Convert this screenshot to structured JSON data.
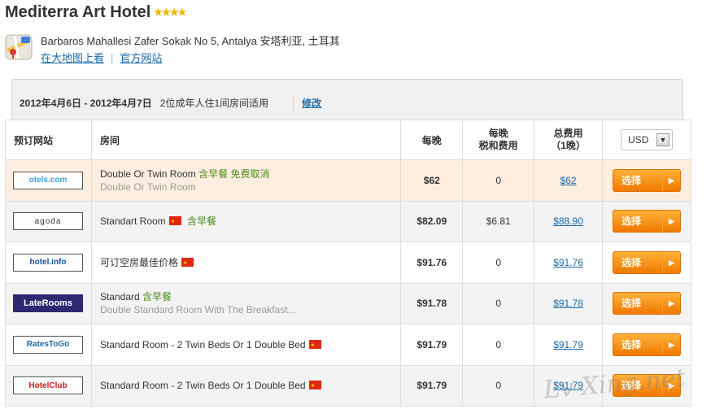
{
  "hotel": {
    "name": "Mediterra Art Hotel",
    "stars": "★★★★",
    "address": "Barbaros Mahallesi Zafer Sokak No 5, Antalya 安塔利亚, 土耳其",
    "map_link": "在大地图上看",
    "site_link": "官方网站"
  },
  "search": {
    "dates": "2012年4月6日 - 2012年4月7日",
    "guests": "2位成年人住1间房间适用",
    "edit": "修改"
  },
  "table": {
    "headers": {
      "site": "预订网站",
      "room": "房间",
      "per_night": "每晚",
      "tax_line1": "每晚",
      "tax_line2": "税和费用",
      "total_line1": "总费用",
      "total_line2": "（1晚）"
    },
    "currency": "USD",
    "rows": [
      {
        "site": "otels.com",
        "room": "Double Or Twin Room",
        "extra": "含早餐 免费取消",
        "sub": "Double Or Twin Room",
        "flag": false,
        "night": "$62",
        "tax": "0",
        "total": "$62",
        "select": "选择"
      },
      {
        "site": "agoda",
        "room": "Standart Room",
        "extra": "含早餐",
        "sub": "",
        "flag": true,
        "night": "$82.09",
        "tax": "$6.81",
        "total": "$88.90",
        "select": "选择"
      },
      {
        "site": "hotel.info",
        "room": "可订空房最佳价格",
        "extra": "",
        "sub": "",
        "flag": true,
        "night": "$91.76",
        "tax": "0",
        "total": "$91.76",
        "select": "选择"
      },
      {
        "site": "LateRooms",
        "room": "Standard",
        "extra": "含早餐",
        "sub": "Double Standard Room With The Breakfast...",
        "flag": false,
        "night": "$91.78",
        "tax": "0",
        "total": "$91.78",
        "select": "选择"
      },
      {
        "site": "RatesToGo",
        "room": "Standard Room - 2 Twin Beds Or 1 Double Bed",
        "extra": "",
        "sub": "",
        "flag": true,
        "night": "$91.79",
        "tax": "0",
        "total": "$91.79",
        "select": "选择"
      },
      {
        "site": "HotelClub",
        "room": "Standard Room - 2 Twin Beds Or 1 Double Bed",
        "extra": "",
        "sub": "",
        "flag": true,
        "night": "$91.79",
        "tax": "0",
        "total": "$91.79",
        "select": "选择"
      }
    ]
  },
  "watermark": "Lv Xing.net"
}
